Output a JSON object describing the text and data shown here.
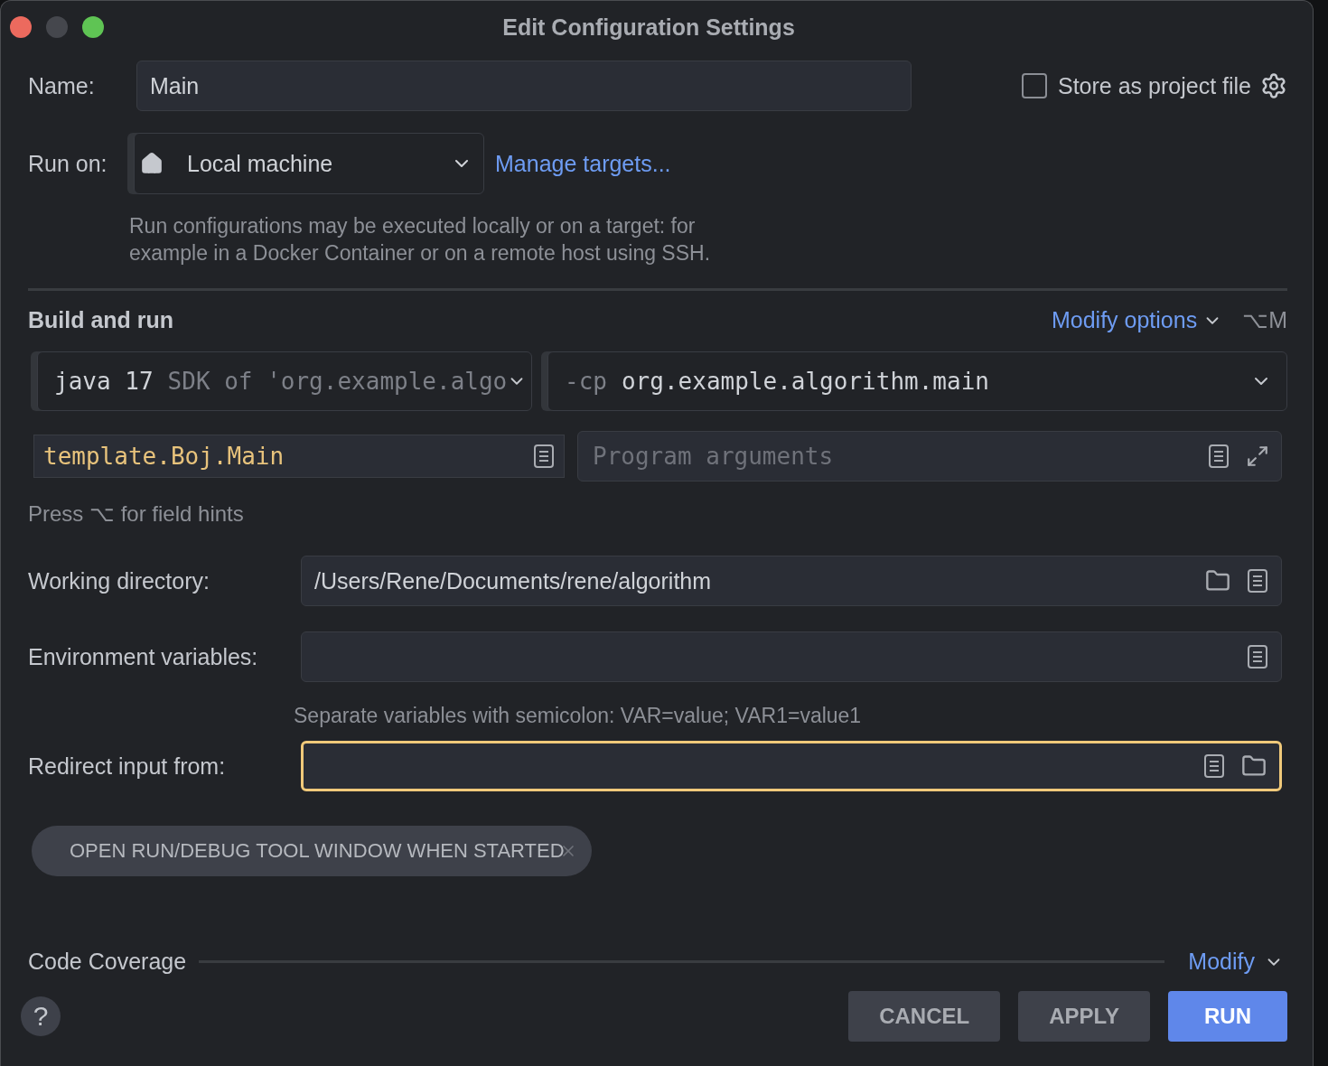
{
  "window": {
    "title": "Edit Configuration Settings"
  },
  "name": {
    "label": "Name:",
    "value": "Main"
  },
  "store": {
    "label": "Store as project file",
    "checked": false
  },
  "run_on": {
    "label": "Run on:",
    "value": "Local machine",
    "link": "Manage targets...",
    "help_lines": [
      "Run configurations may be executed locally or on a target: for",
      "example in a Docker Container or on a remote host using SSH."
    ]
  },
  "build": {
    "title": "Build and run",
    "modify": "Modify options",
    "shortcut": "⌥M",
    "jre": {
      "version": "java 17",
      "hint": "SDK of 'org.example.algo"
    },
    "classpath": {
      "flag": "-cp",
      "value": "org.example.algorithm.main"
    },
    "main_class": "template.Boj.Main",
    "program_args": {
      "placeholder": "Program arguments"
    },
    "hint": "Press ⌥ for field hints"
  },
  "fields": [
    {
      "label": "Working directory:",
      "value": "/Users/Rene/Documents/rene/algorithm",
      "kind": "directory",
      "focused": false
    },
    {
      "label": "Environment variables:",
      "kind": "env",
      "focused": false,
      "hint": "Separate variables with semicolon: VAR=value; VAR1=value1"
    },
    {
      "label": "Redirect input from:",
      "kind": "file",
      "focused": true
    }
  ],
  "chip": {
    "label": "OPEN RUN/DEBUG TOOL WINDOW WHEN STARTED"
  },
  "coverage": {
    "title": "Code Coverage",
    "modify": "Modify"
  },
  "help": "?",
  "buttons": [
    {
      "label": "CANCEL",
      "kind": "secondary"
    },
    {
      "label": "APPLY",
      "kind": "secondary"
    },
    {
      "label": "RUN",
      "kind": "primary"
    }
  ]
}
